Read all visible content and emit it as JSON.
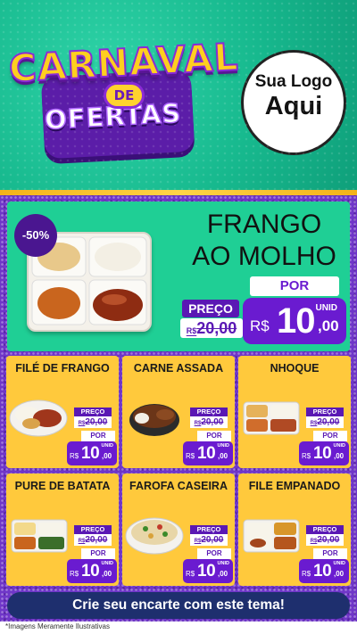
{
  "header": {
    "title_line1": "CARNAVAL",
    "title_connector": "DE",
    "title_line2": "OFERTAS",
    "logo_line1": "Sua Logo",
    "logo_line2": "Aqui"
  },
  "featured": {
    "discount": "-50%",
    "name_line1": "FRANGO",
    "name_line2": "AO MOLHO",
    "por_label": "POR",
    "preco_label": "PREÇO",
    "old_currency": "R$",
    "old_price": "20,00",
    "unit_label": "UNID",
    "new_currency": "R$",
    "new_price_int": "10",
    "new_price_dec": ",00"
  },
  "products": [
    {
      "name": "FILÉ DE FRANGO",
      "preco_label": "PREÇO",
      "old_currency": "R$",
      "old_price": "20,00",
      "por_label": "POR",
      "unit_label": "UNID",
      "currency": "R$",
      "price_int": "10",
      "price_dec": ",00"
    },
    {
      "name": "CARNE ASSADA",
      "preco_label": "PREÇO",
      "old_currency": "R$",
      "old_price": "20,00",
      "por_label": "POR",
      "unit_label": "UNID",
      "currency": "R$",
      "price_int": "10",
      "price_dec": ",00"
    },
    {
      "name": "NHOQUE",
      "preco_label": "PREÇO",
      "old_currency": "R$",
      "old_price": "20,00",
      "por_label": "POR",
      "unit_label": "UNID",
      "currency": "R$",
      "price_int": "10",
      "price_dec": ",00"
    },
    {
      "name": "PURE DE BATATA",
      "preco_label": "PREÇO",
      "old_currency": "R$",
      "old_price": "20,00",
      "por_label": "POR",
      "unit_label": "UNID",
      "currency": "R$",
      "price_int": "10",
      "price_dec": ",00"
    },
    {
      "name": "FAROFA CASEIRA",
      "preco_label": "PREÇO",
      "old_currency": "R$",
      "old_price": "20,00",
      "por_label": "POR",
      "unit_label": "UNID",
      "currency": "R$",
      "price_int": "10",
      "price_dec": ",00"
    },
    {
      "name": "FILE EMPANADO",
      "preco_label": "PREÇO",
      "old_currency": "R$",
      "old_price": "20,00",
      "por_label": "POR",
      "unit_label": "UNID",
      "currency": "R$",
      "price_int": "10",
      "price_dec": ",00"
    }
  ],
  "footer": {
    "cta": "Crie seu encarte com este tema!",
    "disclaimer": "*Imagens Meramente Ilustrativas"
  },
  "colors": {
    "header_teal": "#17b98e",
    "purple": "#6a1bd0",
    "card_yellow": "#ffc93c",
    "feature_green": "#1fcf95",
    "cta_navy": "#1e2f6e"
  }
}
